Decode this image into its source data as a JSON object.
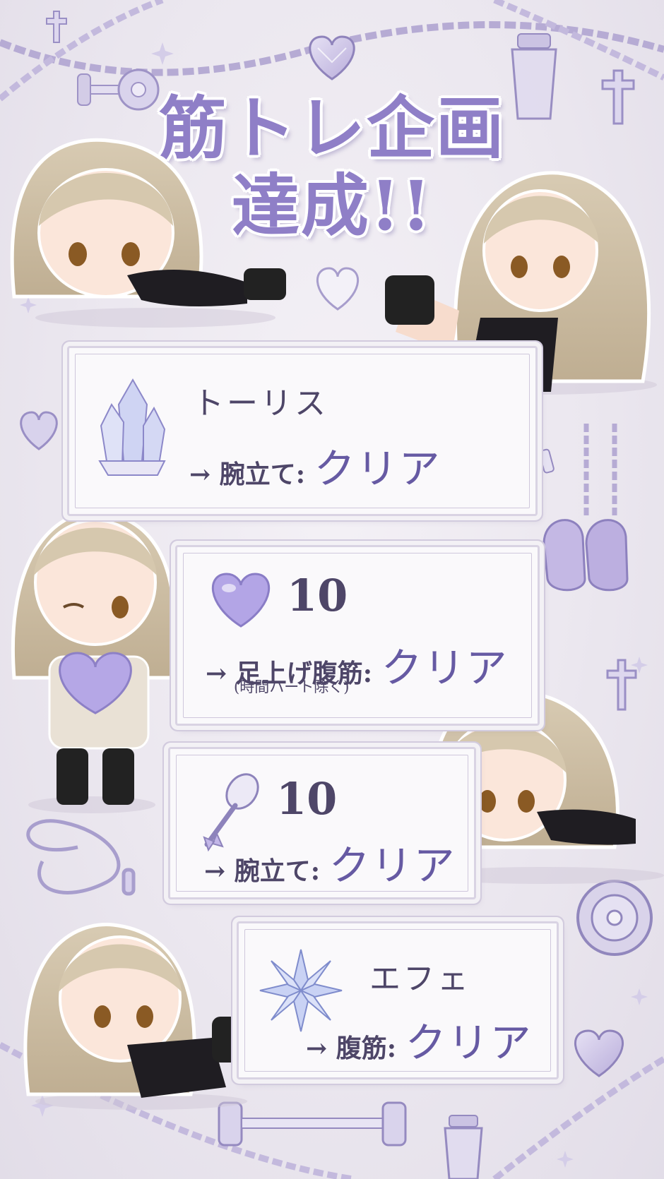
{
  "title": {
    "line1": "筋トレ企画",
    "line2": "達成!!"
  },
  "cards": [
    {
      "name": "トーリス",
      "arrow": "→",
      "exercise": "腕立て:",
      "result": "クリア",
      "icon": "crystal-cluster-icon"
    },
    {
      "count": "10",
      "arrow": "→",
      "exercise": "足上げ腹筋:",
      "result": "クリア",
      "note": "(時間ハート除く)",
      "icon": "heart-icon"
    },
    {
      "count": "10",
      "arrow": "→",
      "exercise": "腕立て:",
      "result": "クリア",
      "icon": "spoon-icon"
    },
    {
      "name": "エフェ",
      "arrow": "→",
      "exercise": "腹筋:",
      "result": "クリア",
      "icon": "snow-crystal-icon"
    }
  ],
  "colors": {
    "accent": "#8f7fc7",
    "text": "#4e4668",
    "background": "#ebe7ef",
    "hair": "#cfc0a6"
  }
}
